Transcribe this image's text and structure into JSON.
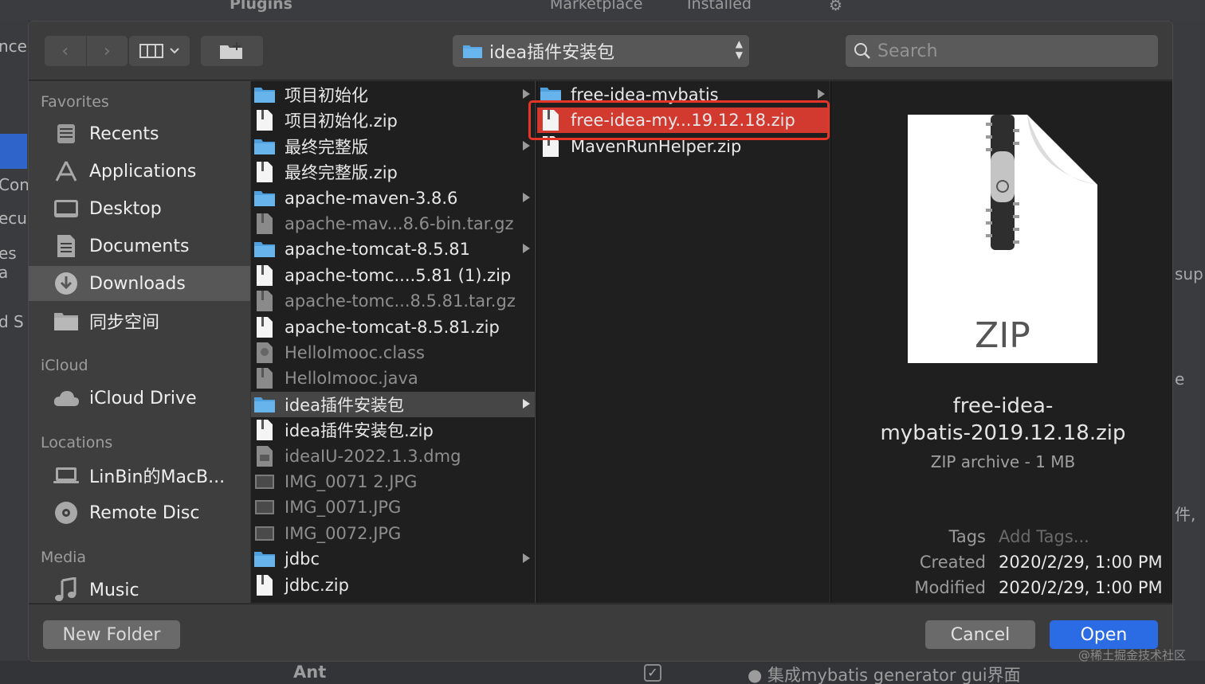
{
  "background": {
    "top_tabs": [
      "Plugins",
      "Marketplace",
      "Installed"
    ],
    "left_fragments": [
      "nce",
      "Con",
      "ecu",
      "es a",
      "d S"
    ],
    "right_fragments": [
      "sup",
      "e",
      "件,"
    ],
    "bottom_fragments": [
      "Ant",
      "● 集成mybatis generator gui界面"
    ],
    "watermark": "@稀土掘金技术社区"
  },
  "toolbar": {
    "back_glyph": "‹",
    "forward_glyph": "›",
    "path_label": "idea插件安装包",
    "search_placeholder": "Search"
  },
  "sidebar": {
    "sections": [
      {
        "heading": "Favorites",
        "items": [
          {
            "label": "Recents",
            "icon": "clock-icon"
          },
          {
            "label": "Applications",
            "icon": "applications-icon"
          },
          {
            "label": "Desktop",
            "icon": "desktop-icon"
          },
          {
            "label": "Documents",
            "icon": "document-icon"
          },
          {
            "label": "Downloads",
            "icon": "download-icon",
            "selected": true
          },
          {
            "label": "同步空间",
            "icon": "folder-icon"
          }
        ]
      },
      {
        "heading": "iCloud",
        "items": [
          {
            "label": "iCloud Drive",
            "icon": "cloud-icon"
          }
        ]
      },
      {
        "heading": "Locations",
        "items": [
          {
            "label": "LinBin的MacB...",
            "icon": "laptop-icon"
          },
          {
            "label": "Remote Disc",
            "icon": "disc-icon"
          }
        ]
      },
      {
        "heading": "Media",
        "items": [
          {
            "label": "Music",
            "icon": "music-note-icon"
          }
        ]
      }
    ]
  },
  "column1": [
    {
      "name": "项目初始化",
      "kind": "folder",
      "arrow": true
    },
    {
      "name": "项目初始化.zip",
      "kind": "zip"
    },
    {
      "name": "最终完整版",
      "kind": "folder",
      "arrow": true
    },
    {
      "name": "最终完整版.zip",
      "kind": "zip"
    },
    {
      "name": "apache-maven-3.8.6",
      "kind": "folder",
      "arrow": true
    },
    {
      "name": "apache-mav...8.6-bin.tar.gz",
      "kind": "archive",
      "dim": true
    },
    {
      "name": "apache-tomcat-8.5.81",
      "kind": "folder",
      "arrow": true
    },
    {
      "name": "apache-tomc....5.81 (1).zip",
      "kind": "zip"
    },
    {
      "name": "apache-tomc...8.5.81.tar.gz",
      "kind": "archive",
      "dim": true
    },
    {
      "name": "apache-tomcat-8.5.81.zip",
      "kind": "zip"
    },
    {
      "name": "HelloImooc.class",
      "kind": "class",
      "dim": true
    },
    {
      "name": "HelloImooc.java",
      "kind": "file",
      "dim": true
    },
    {
      "name": "idea插件安装包",
      "kind": "folder",
      "arrow": true,
      "selected": true
    },
    {
      "name": "idea插件安装包.zip",
      "kind": "zip"
    },
    {
      "name": "ideaIU-2022.1.3.dmg",
      "kind": "dmg",
      "dim": true
    },
    {
      "name": "IMG_0071 2.JPG",
      "kind": "image",
      "dim": true
    },
    {
      "name": "IMG_0071.JPG",
      "kind": "image",
      "dim": true
    },
    {
      "name": "IMG_0072.JPG",
      "kind": "image",
      "dim": true
    },
    {
      "name": "jdbc",
      "kind": "folder",
      "arrow": true
    },
    {
      "name": "jdbc.zip",
      "kind": "zip"
    }
  ],
  "column2": [
    {
      "name": "free-idea-mybatis",
      "kind": "folder",
      "arrow": true
    },
    {
      "name": "free-idea-my...19.12.18.zip",
      "kind": "zip",
      "selected": true
    },
    {
      "name": "MavenRunHelper.zip",
      "kind": "zip"
    }
  ],
  "preview": {
    "icon_label": "ZIP",
    "name_line1": "free-idea-",
    "name_line2": "mybatis-2019.12.18.zip",
    "kind": "ZIP archive - 1 MB",
    "tags_label": "Tags",
    "tags_placeholder": "Add Tags...",
    "created_label": "Created",
    "created_value": "2020/2/29, 1:00 PM",
    "modified_label": "Modified",
    "modified_value": "2020/2/29, 1:00 PM"
  },
  "buttons": {
    "new_folder": "New Folder",
    "cancel": "Cancel",
    "open": "Open"
  },
  "colors": {
    "accent": "#2b6be3",
    "selection_red": "#d23a2f",
    "folder_blue": "#5aa9e6"
  }
}
